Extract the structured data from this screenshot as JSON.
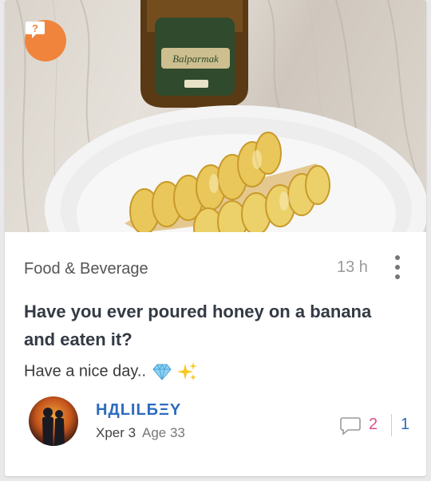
{
  "post": {
    "category": "Food & Beverage",
    "time": "13 h",
    "title": "Have you ever poured honey on a banana and eaten it?",
    "body": "Have a nice day..",
    "jar_label": "Balparmak",
    "badge_icon": "question-bubble-icon"
  },
  "author": {
    "username": "HДLILБΞY",
    "level": "Xper 3",
    "age": "Age 33"
  },
  "stats": {
    "comments": "2",
    "likes": "1"
  },
  "colors": {
    "badge": "#f0843c",
    "username": "#2d6bbf",
    "comments": "#e24a8a",
    "likes": "#2d6bbf"
  }
}
